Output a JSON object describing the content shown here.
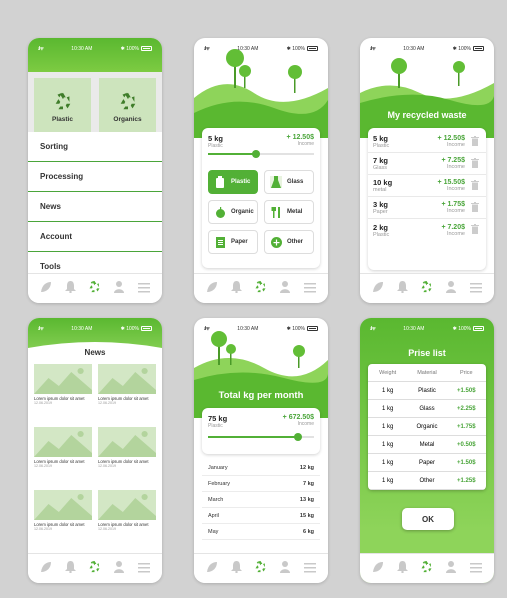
{
  "status": {
    "time": "10:30 AM",
    "battery": "100%"
  },
  "menu_screen": {
    "tiles": [
      {
        "label": "Plastic",
        "icon": "recycle-icon"
      },
      {
        "label": "Organics",
        "icon": "recycle-icon"
      }
    ],
    "items": [
      "Sorting",
      "Processing",
      "News",
      "Account",
      "Tools"
    ]
  },
  "category_screen": {
    "kg": "5 kg",
    "material": "Plastic",
    "amount": "+ 12.50$",
    "amount_label": "Income",
    "slider_level": 0.45,
    "categories": [
      {
        "label": "Plastic",
        "icon": "bottle-icon",
        "active": true
      },
      {
        "label": "Glass",
        "icon": "flask-icon",
        "active": false
      },
      {
        "label": "Organic",
        "icon": "apple-icon",
        "active": false
      },
      {
        "label": "Metal",
        "icon": "cutlery-icon",
        "active": false
      },
      {
        "label": "Paper",
        "icon": "paper-icon",
        "active": false
      },
      {
        "label": "Other",
        "icon": "plus-icon",
        "active": false
      }
    ]
  },
  "recycled_screen": {
    "title": "My recycled waste",
    "rows": [
      {
        "kg": "5 kg",
        "material": "Plastic",
        "amount": "+ 12.50$",
        "label": "Income"
      },
      {
        "kg": "7 kg",
        "material": "Glass",
        "amount": "+ 7.25$",
        "label": "Income"
      },
      {
        "kg": "10 kg",
        "material": "metal",
        "amount": "+ 15.50$",
        "label": "Income"
      },
      {
        "kg": "3 kg",
        "material": "Paper",
        "amount": "+ 1.75$",
        "label": "Income"
      },
      {
        "kg": "2 kg",
        "material": "Plastic",
        "amount": "+ 7.20$",
        "label": "Income"
      }
    ]
  },
  "news_screen": {
    "title": "News",
    "items": [
      {
        "text": "Lorem ipsum dolor sit amet",
        "date": "12.06.2019"
      },
      {
        "text": "Lorem ipsum dolor sit amet",
        "date": "12.06.2019"
      },
      {
        "text": "Lorem ipsum dolor sit amet",
        "date": "12.06.2019"
      },
      {
        "text": "Lorem ipsum dolor sit amet",
        "date": "12.06.2019"
      },
      {
        "text": "Lorem ipsum dolor sit amet",
        "date": "12.06.2019"
      },
      {
        "text": "Lorem ipsum dolor sit amet",
        "date": "12.06.2019"
      }
    ]
  },
  "month_screen": {
    "title": "Total kg per month",
    "kg": "75 kg",
    "material": "Plastic",
    "amount": "+ 672.50$",
    "amount_label": "Income",
    "slider_level": 0.85,
    "months": [
      {
        "month": "January",
        "kg": "12 kg"
      },
      {
        "month": "February",
        "kg": "7 kg"
      },
      {
        "month": "March",
        "kg": "13 kg"
      },
      {
        "month": "April",
        "kg": "15 kg"
      },
      {
        "month": "May",
        "kg": "6 kg"
      }
    ]
  },
  "price_screen": {
    "title": "Prise list",
    "headers": [
      "Weight",
      "Material",
      "Price"
    ],
    "rows": [
      {
        "weight": "1 kg",
        "material": "Plastic",
        "price": "+1.50$"
      },
      {
        "weight": "1 kg",
        "material": "Glass",
        "price": "+2.25$"
      },
      {
        "weight": "1 kg",
        "material": "Organic",
        "price": "+1.75$"
      },
      {
        "weight": "1 kg",
        "material": "Metal",
        "price": "+0.50$"
      },
      {
        "weight": "1 kg",
        "material": "Paper",
        "price": "+1.50$"
      },
      {
        "weight": "1 kg",
        "material": "Other",
        "price": "+1.25$"
      }
    ],
    "ok_label": "OK"
  },
  "tabbar": [
    "leaf-icon",
    "bell-icon",
    "recycle-icon",
    "user-icon",
    "menu-icon"
  ],
  "colors": {
    "green": "#52b036",
    "light_green": "#7dcb42",
    "tile_green": "#cde4bd",
    "background": "#d2d2d2"
  }
}
